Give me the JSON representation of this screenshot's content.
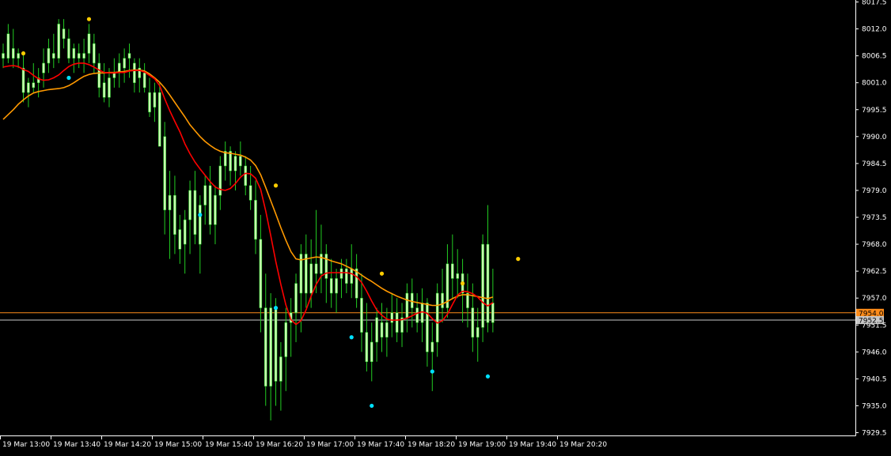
{
  "chart_data": {
    "type": "candlestick",
    "price_scale": {
      "min": 7929.5,
      "max": 8017.5,
      "ticks": [
        "8017.5",
        "8012.0",
        "8006.5",
        "8001.0",
        "7995.5",
        "7990.0",
        "7984.5",
        "7979.0",
        "7973.5",
        "7968.0",
        "7962.5",
        "7957.0",
        "7951.5",
        "7946.0",
        "7940.5",
        "7935.0",
        "7929.5"
      ]
    },
    "time_labels": [
      "19 Mar 13:00",
      "19 Mar 13:40",
      "19 Mar 14:20",
      "19 Mar 15:00",
      "19 Mar 15:40",
      "19 Mar 16:20",
      "19 Mar 17:00",
      "19 Mar 17:40",
      "19 Mar 18:20",
      "19 Mar 19:00",
      "19 Mar 19:40",
      "19 Mar 20:20"
    ],
    "candles": [
      [
        8007,
        8009,
        8004,
        8006
      ],
      [
        8006,
        8013,
        8005,
        8011
      ],
      [
        8008,
        8012,
        8004,
        8006
      ],
      [
        8006,
        8008,
        8004,
        8007
      ],
      [
        8004,
        8007,
        7997,
        7999
      ],
      [
        7999,
        8002,
        7996,
        8001
      ],
      [
        8001,
        8005,
        7999,
        8000
      ],
      [
        8001,
        8004,
        7998,
        8002
      ],
      [
        8003,
        8008,
        8000,
        8005
      ],
      [
        8005,
        8010,
        8003,
        8008
      ],
      [
        8007,
        8011,
        8004,
        8006
      ],
      [
        8006,
        8014,
        8005,
        8013
      ],
      [
        8012,
        8014,
        8008,
        8010
      ],
      [
        8010,
        8012,
        8005,
        8006
      ],
      [
        8006,
        8009,
        8003,
        8008
      ],
      [
        8007,
        8009,
        8004,
        8006
      ],
      [
        8006,
        8010,
        8003,
        8007
      ],
      [
        8007,
        8013,
        8005,
        8011
      ],
      [
        8009,
        8011,
        8003,
        8005
      ],
      [
        8005,
        8007,
        7998,
        8000
      ],
      [
        8001,
        8005,
        7997,
        7998
      ],
      [
        7998,
        8004,
        7996,
        8002
      ],
      [
        8002,
        8006,
        8000,
        8003
      ],
      [
        8003,
        8007,
        8000,
        8005
      ],
      [
        8004,
        8008,
        8001,
        8006
      ],
      [
        8006,
        8009,
        8002,
        8007
      ],
      [
        8005,
        8006,
        7999,
        8001
      ],
      [
        8002,
        8006,
        7999,
        8004
      ],
      [
        8003,
        8005,
        7999,
        8000
      ],
      [
        7999,
        8002,
        7994,
        7995
      ],
      [
        7996,
        8001,
        7993,
        7999
      ],
      [
        7999,
        8001,
        7990,
        7988
      ],
      [
        7990,
        7993,
        7970,
        7975
      ],
      [
        7975,
        7983,
        7965,
        7978
      ],
      [
        7978,
        7982,
        7966,
        7970
      ],
      [
        7971,
        7974,
        7964,
        7967
      ],
      [
        7968,
        7975,
        7962,
        7973
      ],
      [
        7973,
        7981,
        7966,
        7979
      ],
      [
        7979,
        7983,
        7968,
        7970
      ],
      [
        7968,
        7978,
        7962,
        7976
      ],
      [
        7976,
        7982,
        7972,
        7980
      ],
      [
        7980,
        7984,
        7970,
        7972
      ],
      [
        7972,
        7980,
        7968,
        7978
      ],
      [
        7978,
        7986,
        7975,
        7984
      ],
      [
        7984,
        7989,
        7981,
        7987
      ],
      [
        7987,
        7988,
        7980,
        7983
      ],
      [
        7983,
        7987,
        7979,
        7986
      ],
      [
        7986,
        7989,
        7982,
        7984
      ],
      [
        7984,
        7986,
        7978,
        7980
      ],
      [
        7980,
        7984,
        7975,
        7977
      ],
      [
        7977,
        7981,
        7966,
        7969
      ],
      [
        7969,
        7974,
        7950,
        7955
      ],
      [
        7955,
        7962,
        7935,
        7939
      ],
      [
        7939,
        7958,
        7932,
        7955
      ],
      [
        7955,
        7957,
        7935,
        7940
      ],
      [
        7940,
        7948,
        7934,
        7945
      ],
      [
        7945,
        7955,
        7938,
        7952
      ],
      [
        7952,
        7957,
        7945,
        7954
      ],
      [
        7954,
        7962,
        7948,
        7960
      ],
      [
        7958,
        7968,
        7950,
        7966
      ],
      [
        7966,
        7970,
        7955,
        7958
      ],
      [
        7958,
        7969,
        7955,
        7964
      ],
      [
        7964,
        7975,
        7958,
        7962
      ],
      [
        7962,
        7972,
        7958,
        7966
      ],
      [
        7966,
        7968,
        7956,
        7961
      ],
      [
        7961,
        7965,
        7955,
        7958
      ],
      [
        7958,
        7963,
        7954,
        7961
      ],
      [
        7961,
        7965,
        7957,
        7963
      ],
      [
        7963,
        7965,
        7958,
        7960
      ],
      [
        7960,
        7968,
        7957,
        7963
      ],
      [
        7963,
        7966,
        7955,
        7957
      ],
      [
        7957,
        7962,
        7946,
        7950
      ],
      [
        7950,
        7956,
        7942,
        7944
      ],
      [
        7944,
        7952,
        7940,
        7948
      ],
      [
        7948,
        7955,
        7944,
        7953
      ],
      [
        7952,
        7956,
        7946,
        7949
      ],
      [
        7949,
        7955,
        7945,
        7952
      ],
      [
        7952,
        7958,
        7949,
        7954
      ],
      [
        7954,
        7957,
        7948,
        7950
      ],
      [
        7950,
        7956,
        7947,
        7953
      ],
      [
        7953,
        7960,
        7950,
        7958
      ],
      [
        7958,
        7961,
        7951,
        7955
      ],
      [
        7955,
        7958,
        7950,
        7952
      ],
      [
        7952,
        7959,
        7948,
        7956
      ],
      [
        7956,
        7957,
        7943,
        7946
      ],
      [
        7946,
        7952,
        7938,
        7948
      ],
      [
        7948,
        7960,
        7945,
        7958
      ],
      [
        7958,
        7963,
        7952,
        7955
      ],
      [
        7955,
        7968,
        7953,
        7964
      ],
      [
        7964,
        7970,
        7957,
        7961
      ],
      [
        7961,
        7967,
        7957,
        7962
      ],
      [
        7962,
        7965,
        7952,
        7958
      ],
      [
        7958,
        7962,
        7951,
        7955
      ],
      [
        7955,
        7960,
        7946,
        7949
      ],
      [
        7949,
        7955,
        7944,
        7951
      ],
      [
        7951,
        7970,
        7948,
        7968
      ],
      [
        7968,
        7976,
        7950,
        7952
      ],
      [
        7952,
        7963,
        7950,
        7956
      ]
    ],
    "red_line": [
      8004.2,
      8004.4,
      8004.5,
      8004.3,
      8003.7,
      8003.3,
      8002.5,
      8001.8,
      8001.5,
      8001.6,
      8002,
      8002.6,
      8003.5,
      8004.3,
      8004.8,
      8005,
      8005,
      8004.7,
      8004.2,
      8003.6,
      8003.1,
      8003,
      8003,
      8003.1,
      8003.1,
      8003.4,
      8003.5,
      8003.5,
      8003.2,
      8002.5,
      8001.8,
      8000.4,
      7997.7,
      7995.3,
      7993.1,
      7991,
      7988.5,
      7986.5,
      7984.8,
      7983.4,
      7982.1,
      7980.8,
      7979.7,
      7979.2,
      7979,
      7979.4,
      7980.4,
      7981.7,
      7982.5,
      7982.4,
      7981.5,
      7979.2,
      7974.8,
      7969.8,
      7964.5,
      7959.8,
      7955.6,
      7952.6,
      7951.6,
      7952.4,
      7954.6,
      7957.4,
      7959.8,
      7961.5,
      7962.1,
      7962.2,
      7962.2,
      7962.2,
      7962.2,
      7962,
      7961.4,
      7960.2,
      7958.4,
      7956.4,
      7954.6,
      7953.5,
      7952.7,
      7952.5,
      7952.5,
      7952.6,
      7952.9,
      7953.4,
      7953.9,
      7954.2,
      7953.9,
      7952.8,
      7951.9,
      7952.4,
      7953.7,
      7955.7,
      7957.6,
      7958.4,
      7958.3,
      7957.9,
      7957.2,
      7956.1,
      7955.4,
      7956.1
    ],
    "orange_line": [
      7993.5,
      7994.5,
      7995.5,
      7996.6,
      7997.5,
      7998.3,
      7998.9,
      7999.2,
      7999.4,
      7999.6,
      7999.7,
      7999.8,
      8000,
      8000.4,
      8001,
      8001.7,
      8002.3,
      8002.7,
      8002.9,
      8003,
      8003,
      8003.1,
      8003.1,
      8003.2,
      8003.3,
      8003.5,
      8003.6,
      8003.6,
      8003.4,
      8002.8,
      8002,
      8001.1,
      7999.9,
      7998.5,
      7997,
      7995.5,
      7994,
      7992.4,
      7991.2,
      7990,
      7989,
      7988.2,
      7987.5,
      7987,
      7986.7,
      7986.6,
      7986.4,
      7986.2,
      7985.8,
      7985.2,
      7984.1,
      7982.2,
      7979.6,
      7976.9,
      7974.2,
      7971.4,
      7968.8,
      7966.5,
      7965,
      7964.8,
      7965,
      7965.2,
      7965.4,
      7965.3,
      7965,
      7964.6,
      7964.3,
      7964,
      7963.5,
      7963,
      7962.4,
      7961.7,
      7961,
      7960.4,
      7959.7,
      7959,
      7958.4,
      7957.9,
      7957.4,
      7957,
      7956.6,
      7956.3,
      7956.1,
      7955.9,
      7955.7,
      7955.5,
      7955.5,
      7955.8,
      7956.3,
      7956.9,
      7957.4,
      7957.7,
      7957.7,
      7957.5,
      7957.3,
      7957.1,
      7956.9,
      7957.2
    ],
    "fractals_up": [
      {
        "i": 4,
        "price": 8007
      },
      {
        "i": 17,
        "price": 8014
      },
      {
        "i": 54,
        "price": 7980
      },
      {
        "i": 75,
        "price": 7962
      },
      {
        "i": 91,
        "price": 7960
      },
      {
        "i": 102,
        "price": 7965
      }
    ],
    "fractals_down": [
      {
        "i": 13,
        "price": 8002
      },
      {
        "i": 39,
        "price": 7974
      },
      {
        "i": 54,
        "price": 7955
      },
      {
        "i": 69,
        "price": 7949
      },
      {
        "i": 73,
        "price": 7935
      },
      {
        "i": 85,
        "price": 7942
      },
      {
        "i": 96,
        "price": 7941
      }
    ],
    "current_levels": [
      {
        "label": "7954.0",
        "price": 7954.0,
        "color": "#ff8c1a"
      },
      {
        "label": "7952.5",
        "price": 7952.5,
        "color": "#c8c8c8"
      }
    ],
    "colors": {
      "background": "#000000",
      "axis": "#ffffff",
      "candle_body": "#c8ffb0",
      "candle_wick": "#22cc22",
      "red_line": "#ff0000",
      "orange_line": "#ff9900",
      "fractal_up": "#ffcc00",
      "fractal_down": "#00e0ff"
    }
  }
}
